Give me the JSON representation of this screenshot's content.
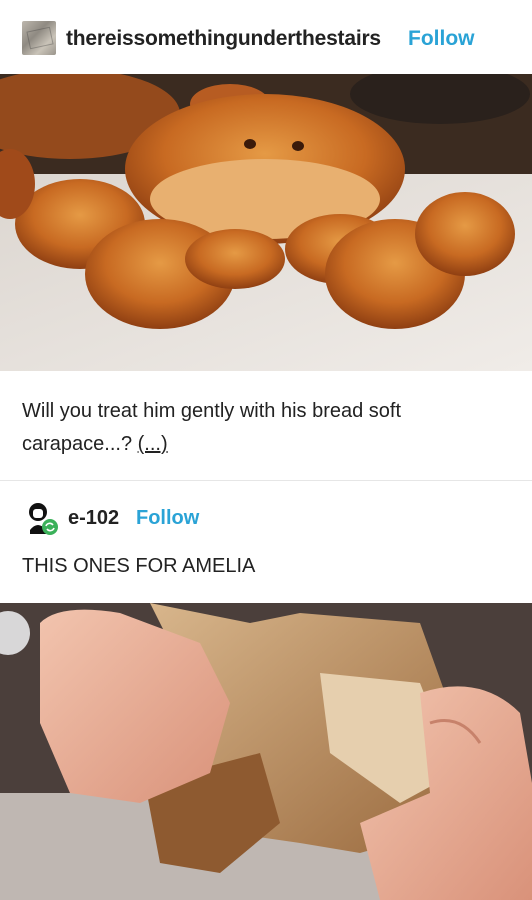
{
  "post": {
    "blog_name": "thereissomethingunderthestairs",
    "follow_label": "Follow",
    "caption_text": "Will you treat him gently with his bread soft carapace...? ",
    "caption_more": "(...)",
    "image_1_icon": "crab-bread-photo",
    "image_2_icon": "torn-bread-photo"
  },
  "reblog": {
    "blog_name": "e-102",
    "follow_label": "Follow",
    "text": "THIS ONES FOR AMELIA",
    "avatar_icon": "reblog-avatar"
  },
  "colors": {
    "accent": "#2aa3d6",
    "text": "#222222",
    "reblog_badge": "#3bb15a"
  }
}
